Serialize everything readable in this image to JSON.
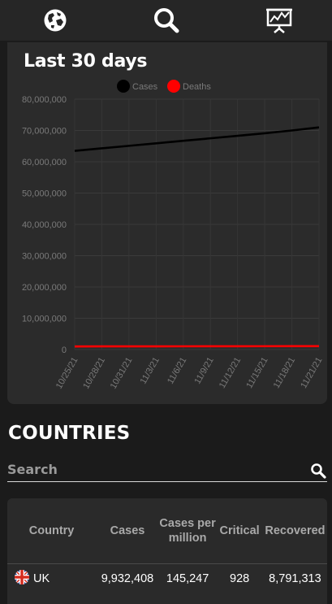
{
  "nav": {
    "globe_icon": "globe-icon",
    "search_icon": "search-icon",
    "chart_icon": "presentation-chart-icon"
  },
  "chart_card": {
    "title": "Last 30 days"
  },
  "chart_data": {
    "type": "line",
    "x": [
      "10/25/21",
      "10/28/21",
      "10/31/21",
      "11/3/21",
      "11/6/21",
      "11/9/21",
      "11/12/21",
      "11/15/21",
      "11/18/21",
      "11/21/21"
    ],
    "series": [
      {
        "name": "Cases",
        "color": "#000000",
        "values": [
          63500000,
          64300000,
          65100000,
          65900000,
          66700000,
          67500000,
          68300000,
          69100000,
          70000000,
          71000000
        ]
      },
      {
        "name": "Deaths",
        "color": "#ff0000",
        "values": [
          1000000,
          1010000,
          1020000,
          1030000,
          1040000,
          1050000,
          1060000,
          1070000,
          1080000,
          1090000
        ]
      }
    ],
    "y_ticks": [
      "80,000,000",
      "70,000,000",
      "60,000,000",
      "50,000,000",
      "40,000,000",
      "30,000,000",
      "20,000,000",
      "10,000,000",
      "0"
    ],
    "ylim": [
      0,
      80000000
    ],
    "grid": true,
    "legend_position": "top-center"
  },
  "countries": {
    "title": "COUNTRIES",
    "search_placeholder": "Search",
    "columns": [
      {
        "key": "country",
        "label": "Country"
      },
      {
        "key": "cases",
        "label": "Cases"
      },
      {
        "key": "cases_per_million",
        "label": "Cases per million"
      },
      {
        "key": "critical",
        "label": "Critical"
      },
      {
        "key": "recovered",
        "label": "Recovered"
      }
    ],
    "rows": [
      {
        "country": "UK",
        "flag_icon": "uk-flag-icon",
        "cases": "9,932,408",
        "cases_per_million": "145,247",
        "critical": "928",
        "recovered": "8,791,313"
      }
    ]
  }
}
